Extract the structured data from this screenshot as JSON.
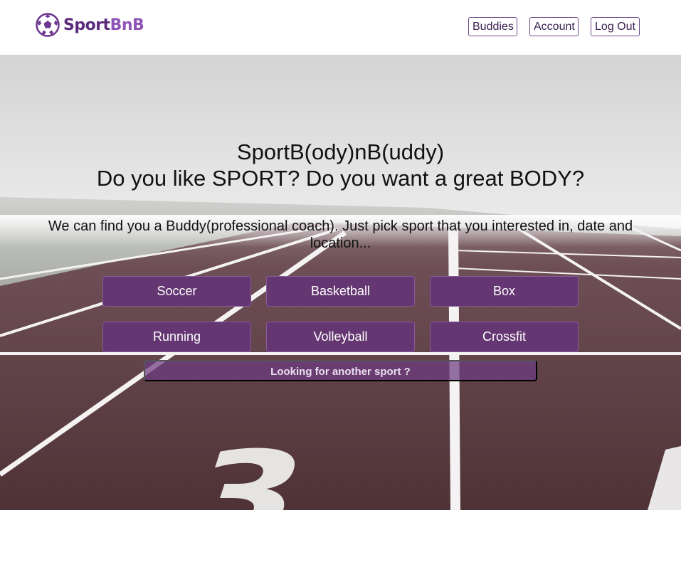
{
  "brand": {
    "logo_part1": "Sport",
    "logo_part2": "BnB",
    "color_primary": "#5a2a7a",
    "color_secondary": "#8e55b5",
    "icon": "soccer-ball-icon"
  },
  "nav": {
    "buddies": "Buddies",
    "account": "Account",
    "logout": "Log Out"
  },
  "hero": {
    "title_line1": "SportB(ody)nB(uddy)",
    "title_line2": "Do you like SPORT? Do you want a great BODY?",
    "subtitle": "We can find you a Buddy(professional coach). Just pick sport that you interested in, date and location...",
    "lane_number": "3",
    "sports": [
      "Soccer",
      "Basketball",
      "Box",
      "Running",
      "Volleyball",
      "Crossfit"
    ],
    "another_sport": "Looking for another sport ?",
    "button_color": "#643672"
  }
}
